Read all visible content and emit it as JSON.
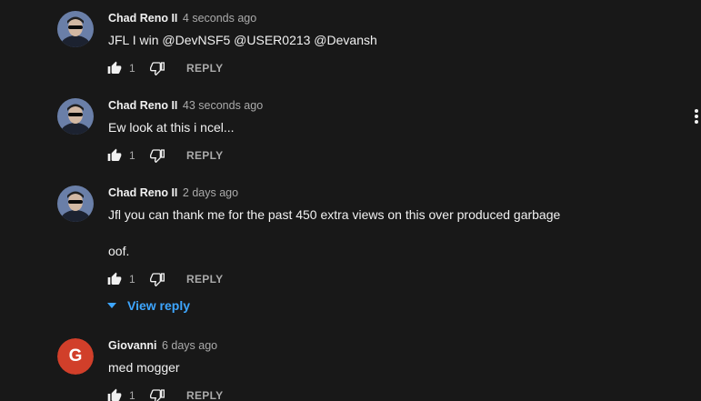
{
  "comments": [
    {
      "author": "Chad Reno II",
      "time": "4 seconds ago",
      "text": [
        "JFL I win @DevNSF5 @USER0213 @Devansh"
      ],
      "likes": "1",
      "reply_label": "REPLY",
      "avatar_icon": "profile-photo"
    },
    {
      "author": "Chad Reno II",
      "time": "43 seconds ago",
      "text": [
        "Ew look at this i ncel..."
      ],
      "likes": "1",
      "reply_label": "REPLY",
      "avatar_icon": "profile-photo"
    },
    {
      "author": "Chad Reno II",
      "time": "2 days ago",
      "text": [
        "Jfl you can thank me for the past 450 extra views on this over produced garbage",
        "oof."
      ],
      "likes": "1",
      "reply_label": "REPLY",
      "avatar_icon": "profile-photo",
      "view_replies_label": "View reply"
    },
    {
      "author": "Giovanni",
      "time": "6 days ago",
      "text": [
        "med mogger"
      ],
      "likes": "1",
      "reply_label": "REPLY",
      "avatar_letter": "G",
      "avatar_color": "#d13f2a"
    }
  ],
  "colors": {
    "background": "#181818",
    "text_primary": "#f1f1f1",
    "text_secondary": "#aaaaaa",
    "link_blue": "#3ea6ff"
  },
  "icons": {
    "like": "thumbs-up-icon",
    "dislike": "thumbs-down-icon",
    "more": "more-vert-icon",
    "expand": "chevron-down-icon"
  }
}
